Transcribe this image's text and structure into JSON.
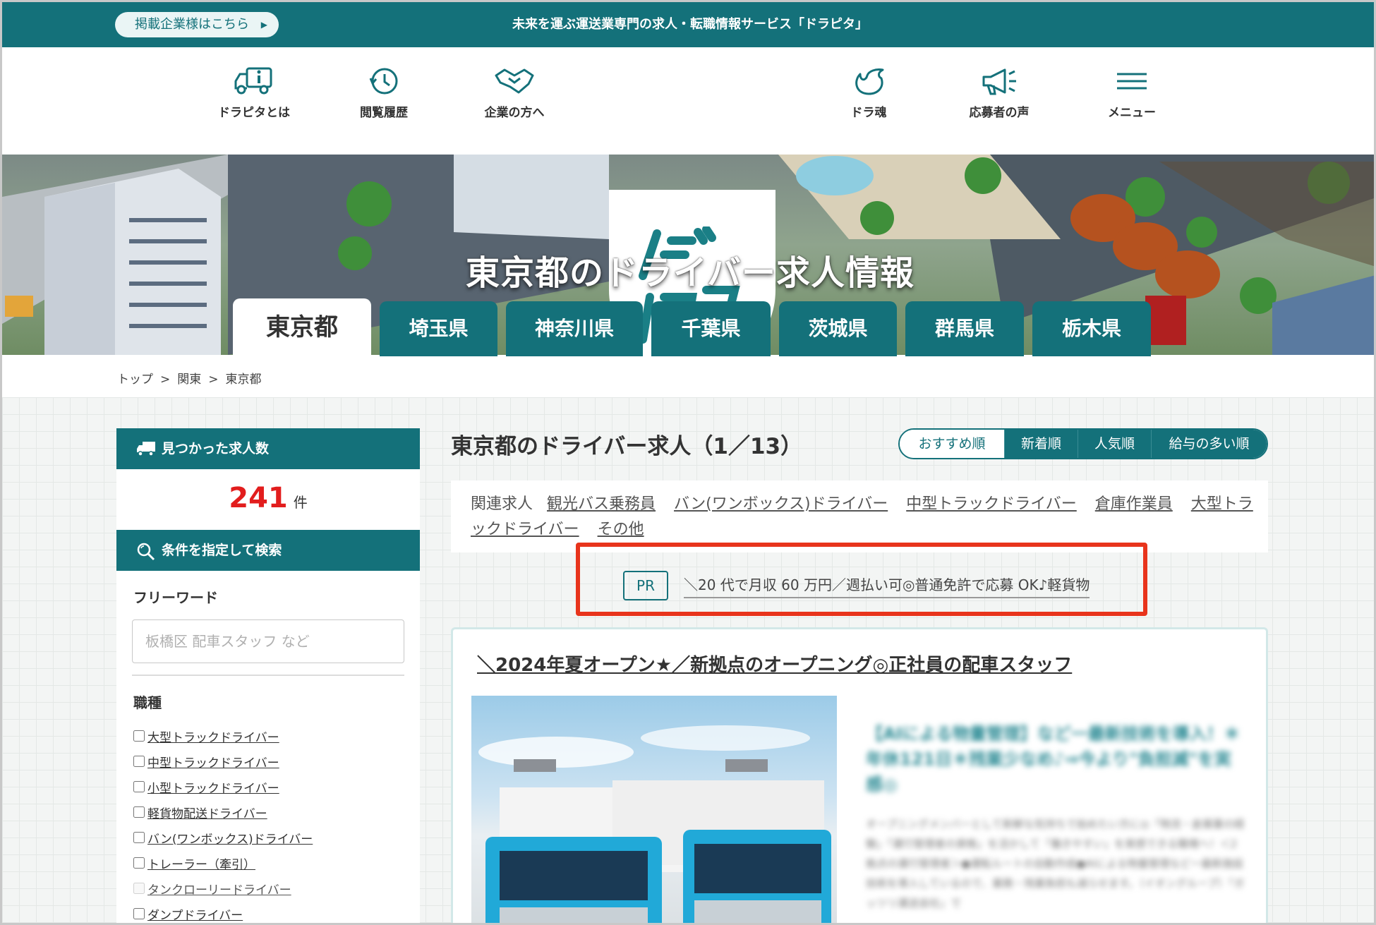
{
  "topbar": {
    "advertiser_label": "掲載企業様はこちら",
    "tagline": "未来を運ぶ運送業専門の求人・転職情報サービス「ドラピタ」"
  },
  "nav": {
    "about": "ドラピタとは",
    "history": "閲覧履歴",
    "company": "企業の方へ",
    "spirit": "ドラ魂",
    "voices": "応募者の声",
    "menu": "メニュー"
  },
  "logo": {
    "line1": "ドラ",
    "line2": "ピタ"
  },
  "hero": {
    "title": "東京都のドライバー求人情報"
  },
  "prefectures": [
    "東京都",
    "埼玉県",
    "神奈川県",
    "千葉県",
    "茨城県",
    "群馬県",
    "栃木県"
  ],
  "active_prefecture": "東京都",
  "breadcrumb": [
    "トップ",
    "関東",
    "東京都"
  ],
  "sidebar": {
    "found_header": "見つかった求人数",
    "count": "241",
    "count_unit": "件",
    "search_header": "条件を指定して検索",
    "freeword_label": "フリーワード",
    "freeword_placeholder": "板橋区 配車スタッフ など",
    "jobtype_label": "職種",
    "jobtypes": [
      "大型トラックドライバー",
      "中型トラックドライバー",
      "小型トラックドライバー",
      "軽貨物配送ドライバー",
      "バン(ワンボックス)ドライバー",
      "トレーラー（牽引）",
      "タンクローリードライバー",
      "ダンプドライバー"
    ]
  },
  "main": {
    "title": "東京都のドライバー求人（1／13）",
    "sort": [
      "おすすめ順",
      "新着順",
      "人気順",
      "給与の多い順"
    ],
    "related_label": "関連求人",
    "related": [
      "観光バス乗務員",
      "バン(ワンボックス)ドライバー",
      "中型トラックドライバー",
      "倉庫作業員",
      "大型トラックドライバー",
      "その他"
    ],
    "pr_badge": "PR",
    "pr_text": "＼20 代で月収 60 万円／週払い可◎普通免許で応募 OK♪軽貨物",
    "job_title": "＼2024年夏オープン★／新拠点のオープニング◎正社員の配車スタッフ",
    "blurred_heading": "【AIによる物量管理】など一最新技術を導入！＊年休121日＊残業少なめ♪⇒今より\"負担減\"を実感◎",
    "blurred_text": "オープニングメンバーとして新鮮な気持ちで始めたい方に◎「物流・倉庫業の経験」「運行管理者の資格」を活かして「働きやすい」を実感できる職場へ！＜2拠点の運行管理者＞●運転ルートの自動作成●AIによる物量管理など一最新施設技術を導入しているので、業務・残業負担も減らせます。（イオングループ）「ガッツリ運送会社」で"
  },
  "colors": {
    "brand": "#14717a",
    "count_red": "#e21d1d",
    "highlight": "#e8341c"
  }
}
